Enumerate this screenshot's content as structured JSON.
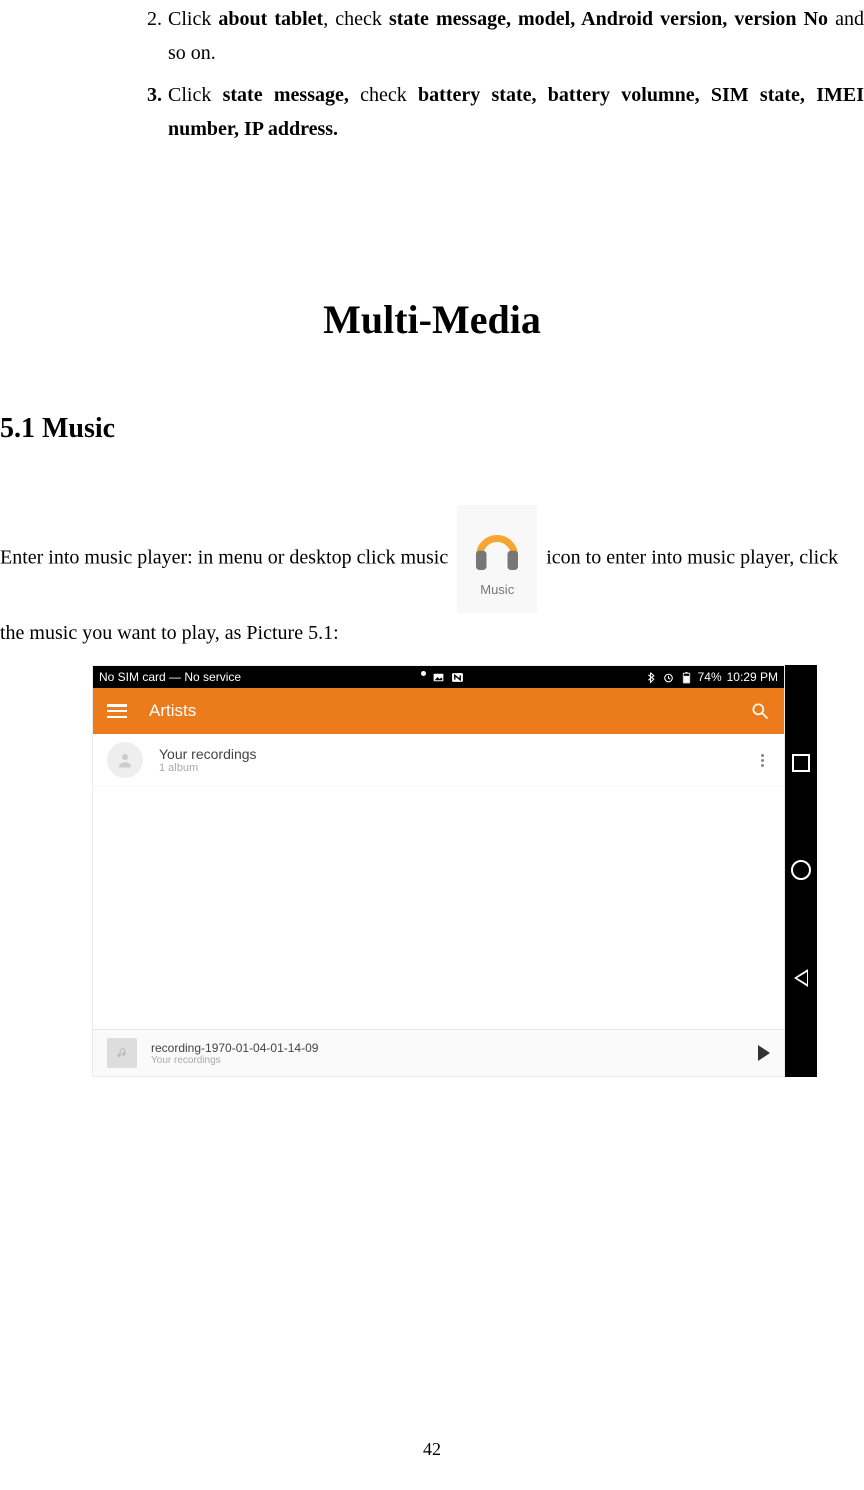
{
  "list": {
    "item2": {
      "num": "2.",
      "pre": "Click ",
      "b1": "about tablet",
      "mid1": ", check ",
      "b2": "state message, model, Android version, version No",
      "post": " and so on."
    },
    "item3": {
      "num": "3.",
      "pre": "Click ",
      "b1": "state message,",
      "mid1": " check ",
      "b2": "battery state, battery volumne, SIM state, IMEI number, IP address."
    }
  },
  "chapter": "Multi-Media",
  "section": "5.1 Music",
  "para": {
    "pre": "Enter into music player: in menu or desktop click music",
    "post": "icon to enter into music player, click the music you want to play, as Picture 5.1:"
  },
  "music_icon_label": "Music",
  "screenshot": {
    "status": {
      "left": "No SIM card — No service",
      "battery": "74%",
      "time": "10:29 PM"
    },
    "appbar_title": "Artists",
    "row": {
      "title": "Your recordings",
      "sub": "1 album"
    },
    "now_playing": {
      "title": "recording-1970-01-04-01-14-09",
      "sub": "Your recordings"
    }
  },
  "page_number": "42"
}
